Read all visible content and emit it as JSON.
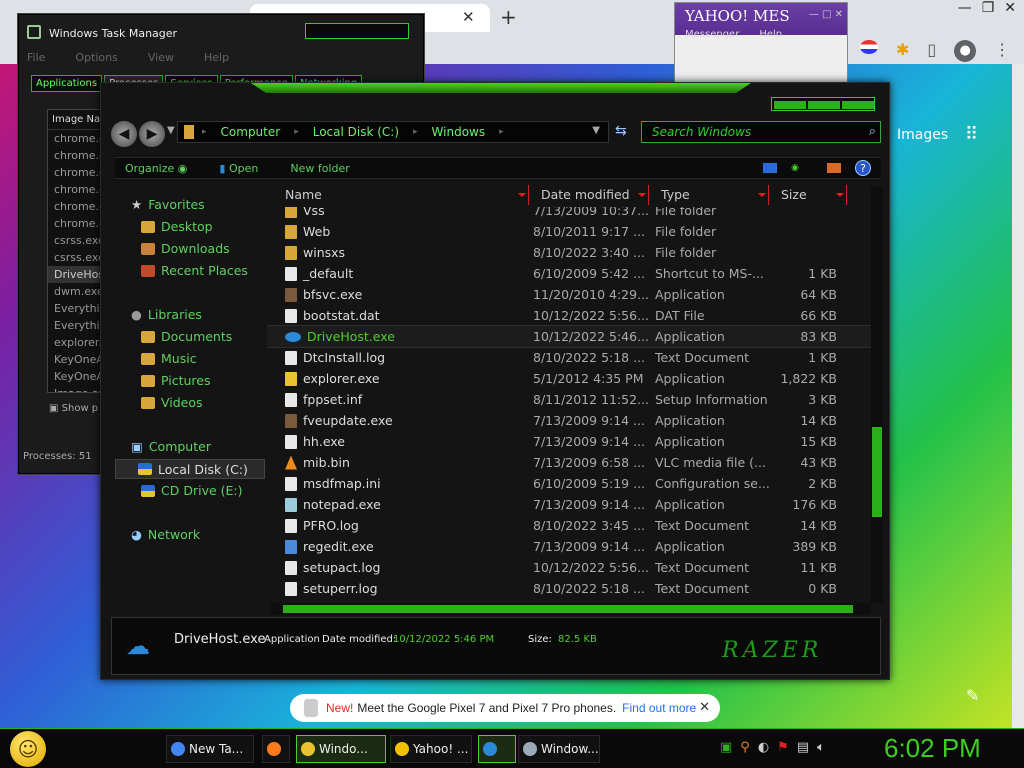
{
  "browser": {
    "tab_close": "✕",
    "tab_new": "+",
    "window_controls": [
      "—",
      "❐",
      "✕"
    ],
    "images_link": "Images",
    "apps_icon": "⋮⋮",
    "avatar_glyph": "●"
  },
  "yahoo": {
    "title": "YAHOO! MES",
    "controls": "— □ ✕",
    "menu": [
      "Messenger",
      "Help"
    ]
  },
  "notification": {
    "new_label": "New!",
    "text": "Meet the Google Pixel 7 and Pixel 7 Pro phones.",
    "link": "Find out more",
    "close": "✕"
  },
  "task_manager": {
    "title": "Windows Task Manager",
    "menu": [
      "File",
      "Options",
      "View",
      "Help"
    ],
    "tabs": [
      "Applications",
      "Processes",
      "Services",
      "Performance",
      "Networking"
    ],
    "active_tab": "Processes",
    "column_header": "Image Na",
    "processes": [
      "chrome.e",
      "chrome.e",
      "chrome.e",
      "chrome.e",
      "chrome.e",
      "chrome.e",
      "csrss.exe",
      "csrss.exe",
      "DriveHost",
      "dwm.exe",
      "Everythin",
      "Everythin",
      "explorer.e",
      "KeyOneA",
      "KeyOneA",
      "Image ave"
    ],
    "selected_process": "DriveHost",
    "show_all": "Show p",
    "status": "Processes: 51"
  },
  "explorer": {
    "breadcrumbs": [
      "Computer",
      "Local Disk (C:)",
      "Windows"
    ],
    "search_placeholder": "Search Windows",
    "toolbar": {
      "organize": "Organize",
      "open": "Open",
      "new_folder": "New folder",
      "help": "?"
    },
    "nav": {
      "favorites": "Favorites",
      "desktop": "Desktop",
      "downloads": "Downloads",
      "recent": "Recent Places",
      "libraries": "Libraries",
      "documents": "Documents",
      "music": "Music",
      "pictures": "Pictures",
      "videos": "Videos",
      "computer": "Computer",
      "local_disk": "Local Disk (C:)",
      "cd_drive": "CD Drive (E:)",
      "network": "Network"
    },
    "columns": {
      "name": "Name",
      "date": "Date modified",
      "type": "Type",
      "size": "Size"
    },
    "files": [
      {
        "name": "Vss",
        "date": "7/13/2009 10:37...",
        "type": "File folder",
        "size": "",
        "icon": "folder"
      },
      {
        "name": "Web",
        "date": "8/10/2011 9:17 ...",
        "type": "File folder",
        "size": "",
        "icon": "folder"
      },
      {
        "name": "winsxs",
        "date": "8/10/2022 3:40 ...",
        "type": "File folder",
        "size": "",
        "icon": "folder"
      },
      {
        "name": "_default",
        "date": "6/10/2009 5:42 ...",
        "type": "Shortcut to MS-...",
        "size": "1 KB",
        "icon": "shortcut"
      },
      {
        "name": "bfsvc.exe",
        "date": "11/20/2010 4:29...",
        "type": "Application",
        "size": "64 KB",
        "icon": "exe"
      },
      {
        "name": "bootstat.dat",
        "date": "10/12/2022 5:56...",
        "type": "DAT File",
        "size": "66 KB",
        "icon": "file"
      },
      {
        "name": "DriveHost.exe",
        "date": "10/12/2022 5:46...",
        "type": "Application",
        "size": "83 KB",
        "icon": "cloud"
      },
      {
        "name": "DtcInstall.log",
        "date": "8/10/2022 5:18 ...",
        "type": "Text Document",
        "size": "1 KB",
        "icon": "file"
      },
      {
        "name": "explorer.exe",
        "date": "5/1/2012 4:35 PM",
        "type": "Application",
        "size": "1,822 KB",
        "icon": "explorer"
      },
      {
        "name": "fppset.inf",
        "date": "8/11/2012 11:52...",
        "type": "Setup Information",
        "size": "3 KB",
        "icon": "file"
      },
      {
        "name": "fveupdate.exe",
        "date": "7/13/2009 9:14 ...",
        "type": "Application",
        "size": "14 KB",
        "icon": "exe"
      },
      {
        "name": "hh.exe",
        "date": "7/13/2009 9:14 ...",
        "type": "Application",
        "size": "15 KB",
        "icon": "help"
      },
      {
        "name": "mib.bin",
        "date": "7/13/2009 6:58 ...",
        "type": "VLC media file (...",
        "size": "43 KB",
        "icon": "vlc"
      },
      {
        "name": "msdfmap.ini",
        "date": "6/10/2009 5:19 ...",
        "type": "Configuration se...",
        "size": "2 KB",
        "icon": "file"
      },
      {
        "name": "notepad.exe",
        "date": "7/13/2009 9:14 ...",
        "type": "Application",
        "size": "176 KB",
        "icon": "notepad"
      },
      {
        "name": "PFRO.log",
        "date": "8/10/2022 3:45 ...",
        "type": "Text Document",
        "size": "14 KB",
        "icon": "file"
      },
      {
        "name": "regedit.exe",
        "date": "7/13/2009 9:14 ...",
        "type": "Application",
        "size": "389 KB",
        "icon": "regedit"
      },
      {
        "name": "setupact.log",
        "date": "10/12/2022 5:56...",
        "type": "Text Document",
        "size": "11 KB",
        "icon": "file"
      },
      {
        "name": "setuperr.log",
        "date": "8/10/2022 5:18 ...",
        "type": "Text Document",
        "size": "0 KB",
        "icon": "file"
      }
    ],
    "selected_file": "DriveHost.exe",
    "details": {
      "name": "DriveHost.exe",
      "type": "Application",
      "date_label": "Date modified:",
      "date_value": "10/12/2022 5:46 PM",
      "size_label": "Size:",
      "size_value": "82.5 KB"
    },
    "brand": "RAZER"
  },
  "taskbar": {
    "start_glyph": "☺",
    "buttons": [
      {
        "label": "New Ta...",
        "color": "#4285f4"
      },
      {
        "label": "",
        "color": "#ff7a1a"
      },
      {
        "label": "Windo...",
        "color": "#e8c230"
      },
      {
        "label": "Yahoo! ...",
        "color": "#f2c200"
      },
      {
        "label": "",
        "color": "#2a8ad8"
      },
      {
        "label": "Window...",
        "color": "#9ab"
      }
    ],
    "clock": "6:02 PM"
  },
  "colors": {
    "accent_green": "#4ccf2e",
    "selection_green": "#2bb01a",
    "onedrive_blue": "#2a8ad8"
  }
}
